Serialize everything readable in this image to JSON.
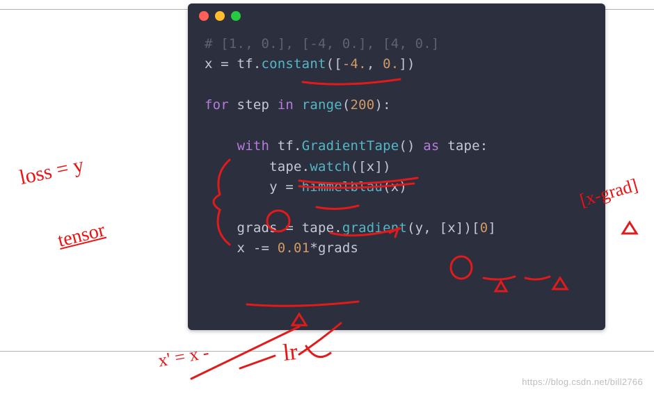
{
  "window": {
    "traffic_lights": [
      "close",
      "minimize",
      "zoom"
    ]
  },
  "code": {
    "lines": [
      {
        "text": "# [1., 0.], [-4, 0.], [4, 0.]",
        "class": "c-comment"
      },
      {
        "tokens": [
          {
            "t": "x",
            "c": "c-ident"
          },
          {
            "t": " = ",
            "c": "c-op"
          },
          {
            "t": "tf.",
            "c": "c-ident"
          },
          {
            "t": "constant",
            "c": "c-func"
          },
          {
            "t": "([",
            "c": "c-op"
          },
          {
            "t": "-4.",
            "c": "c-num"
          },
          {
            "t": ", ",
            "c": "c-op"
          },
          {
            "t": "0.",
            "c": "c-num"
          },
          {
            "t": "])",
            "c": "c-op"
          }
        ]
      },
      {
        "text": "",
        "class": ""
      },
      {
        "tokens": [
          {
            "t": "for",
            "c": "c-kw"
          },
          {
            "t": " step ",
            "c": "c-ident"
          },
          {
            "t": "in",
            "c": "c-kw"
          },
          {
            "t": " ",
            "c": "c-op"
          },
          {
            "t": "range",
            "c": "c-func"
          },
          {
            "t": "(",
            "c": "c-op"
          },
          {
            "t": "200",
            "c": "c-num"
          },
          {
            "t": "):",
            "c": "c-op"
          }
        ]
      },
      {
        "text": "",
        "class": ""
      },
      {
        "tokens": [
          {
            "t": "    ",
            "c": ""
          },
          {
            "t": "with",
            "c": "c-kw"
          },
          {
            "t": " tf.",
            "c": "c-ident"
          },
          {
            "t": "GradientTape",
            "c": "c-func"
          },
          {
            "t": "() ",
            "c": "c-op"
          },
          {
            "t": "as",
            "c": "c-kw"
          },
          {
            "t": " tape:",
            "c": "c-ident"
          }
        ]
      },
      {
        "tokens": [
          {
            "t": "        tape.",
            "c": "c-ident"
          },
          {
            "t": "watch",
            "c": "c-func"
          },
          {
            "t": "([x])",
            "c": "c-op"
          }
        ]
      },
      {
        "tokens": [
          {
            "t": "        y = ",
            "c": "c-ident"
          },
          {
            "t": "himmelblau",
            "c": "c-func"
          },
          {
            "t": "(x)",
            "c": "c-op"
          }
        ]
      },
      {
        "text": "",
        "class": ""
      },
      {
        "tokens": [
          {
            "t": "    grads = tape.",
            "c": "c-ident"
          },
          {
            "t": "gradient",
            "c": "c-func"
          },
          {
            "t": "(y, [x])[",
            "c": "c-op"
          },
          {
            "t": "0",
            "c": "c-num"
          },
          {
            "t": "]",
            "c": "c-op"
          }
        ]
      },
      {
        "tokens": [
          {
            "t": "    x -= ",
            "c": "c-ident"
          },
          {
            "t": "0.01",
            "c": "c-num"
          },
          {
            "t": "*grads",
            "c": "c-ident"
          }
        ]
      }
    ]
  },
  "annotations": {
    "loss": "loss = y",
    "tensor": "tensor",
    "xgrad": "[x-grad]",
    "xprime": "x' = x -",
    "lr": "lr",
    "color": "#e11b1b"
  },
  "watermark": "https://blog.csdn.net/bill2766"
}
